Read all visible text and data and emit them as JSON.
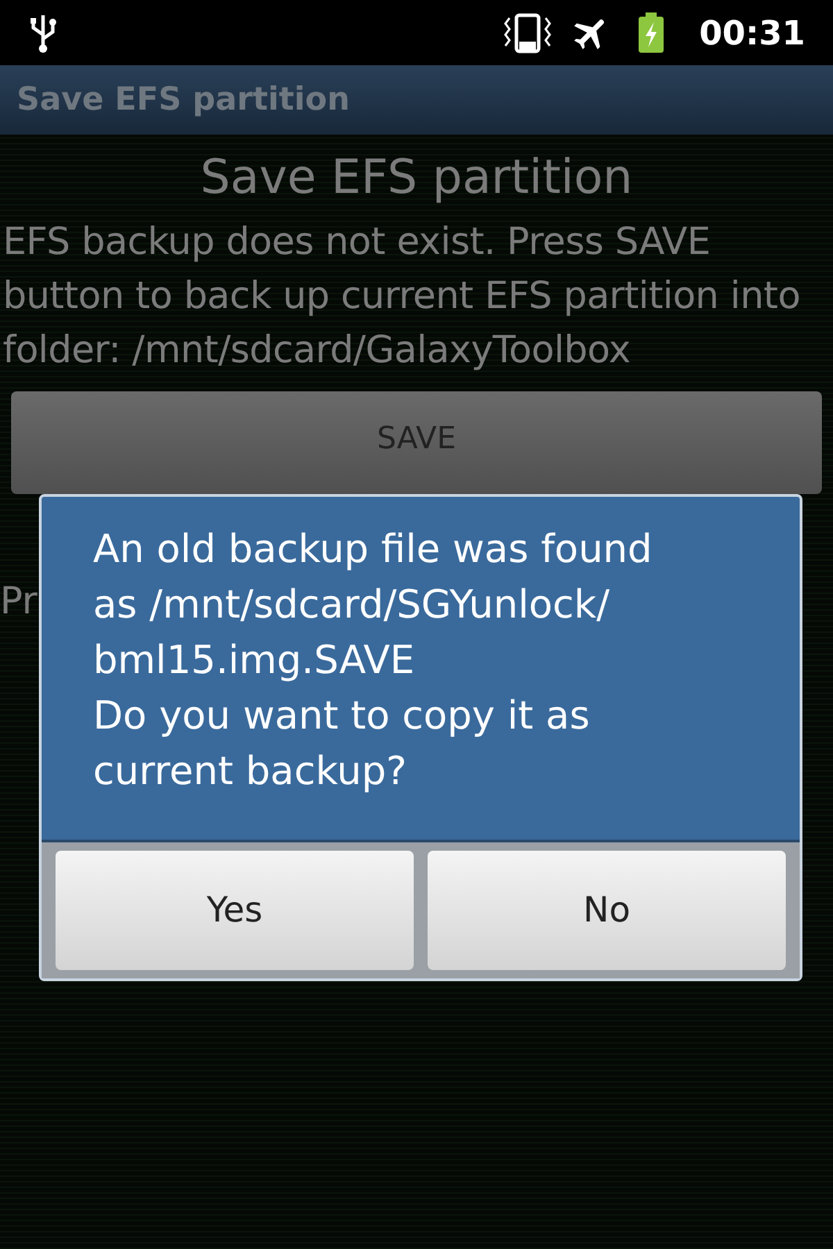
{
  "status_bar": {
    "time": "00:31"
  },
  "title_bar": {
    "title": "Save EFS partition"
  },
  "content": {
    "heading": "Save EFS partition",
    "message": "EFS backup does not exist. Press SAVE button to back up current EFS partition into folder: /mnt/sdcard/GalaxyToolbox",
    "button": "SAVE",
    "text_fragment": "Pr"
  },
  "dialog": {
    "message_lines": [
      "An old backup file was found",
      "as /mnt/sdcard/SGYunlock/",
      "bml15.img.SAVE",
      "Do you want to copy it as",
      "current backup?"
    ],
    "buttons": [
      "Yes",
      "No"
    ]
  }
}
